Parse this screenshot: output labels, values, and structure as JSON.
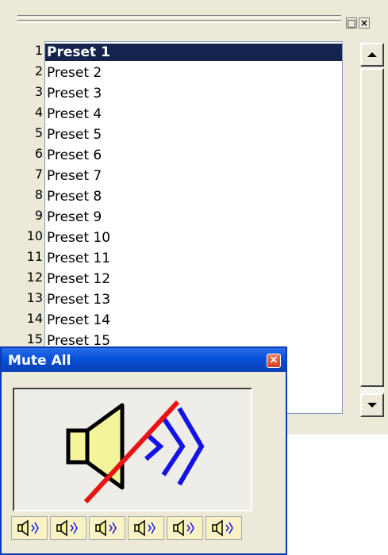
{
  "presets_panel": {
    "items": [
      {
        "num": "1",
        "label": "Preset 1",
        "selected": true
      },
      {
        "num": "2",
        "label": "Preset 2"
      },
      {
        "num": "3",
        "label": "Preset 3"
      },
      {
        "num": "4",
        "label": "Preset 4"
      },
      {
        "num": "5",
        "label": "Preset 5"
      },
      {
        "num": "6",
        "label": "Preset 6"
      },
      {
        "num": "7",
        "label": "Preset 7"
      },
      {
        "num": "8",
        "label": "Preset 8"
      },
      {
        "num": "9",
        "label": "Preset 9"
      },
      {
        "num": "10",
        "label": "Preset 10"
      },
      {
        "num": "11",
        "label": "Preset 11"
      },
      {
        "num": "12",
        "label": "Preset 12"
      },
      {
        "num": "13",
        "label": "Preset 13"
      },
      {
        "num": "14",
        "label": "Preset 14"
      },
      {
        "num": "15",
        "label": "Preset 15"
      }
    ]
  },
  "mute_window": {
    "title": "Mute All",
    "strip_count": 6
  },
  "colors": {
    "selection": "#14244e",
    "titlebar": "#0752d9",
    "speaker_fill": "#f4f49a",
    "waves": "#1414e6",
    "mute_line": "#e81414"
  }
}
